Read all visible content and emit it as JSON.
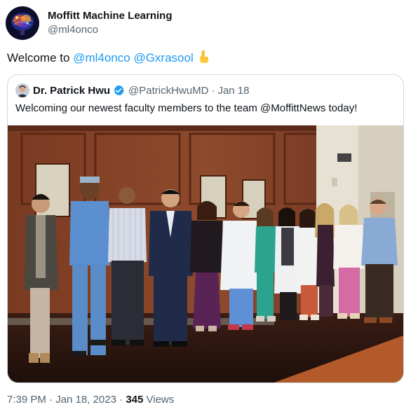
{
  "author": {
    "display_name": "Moffitt Machine Learning",
    "handle": "@ml4onco",
    "avatar_icon": "brain-avatar-icon"
  },
  "tweet": {
    "text_prefix": "Welcome to",
    "mentions": [
      "@ml4onco",
      "@Gxrasool"
    ],
    "emoji": "pointing-down-hand"
  },
  "quote": {
    "display_name": "Dr. Patrick Hwu",
    "verified": true,
    "handle": "@PatrickHwuMD",
    "separator": "·",
    "date": "Jan 18",
    "text": "Welcoming our newest faculty members to the team @MoffittNews today!",
    "image_icon": "group-photo"
  },
  "meta": {
    "time": "7:39 PM",
    "separator": "·",
    "date": "Jan 18, 2023",
    "views_count": "345",
    "views_label": "Views"
  },
  "colors": {
    "link": "#1d9bf0",
    "text": "#0f1419",
    "muted": "#536471",
    "border": "#cfd9de"
  }
}
